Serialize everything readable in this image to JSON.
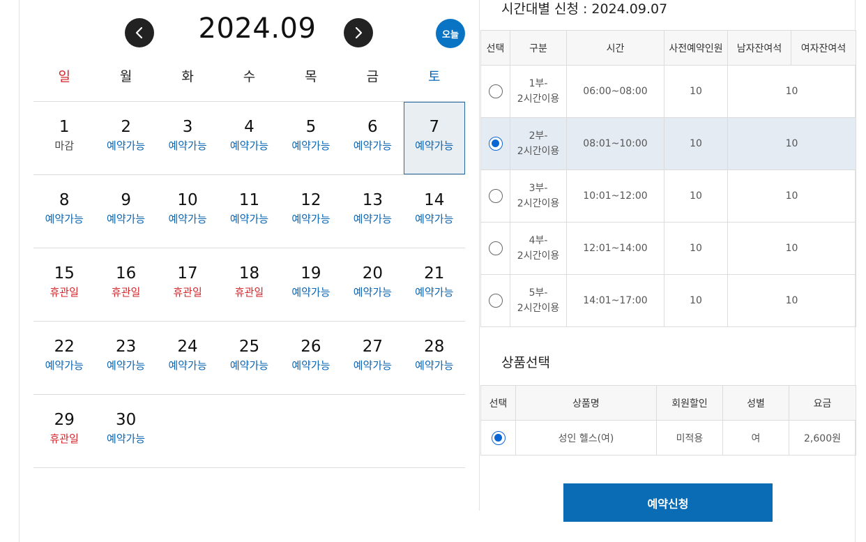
{
  "calendar": {
    "title": "2024.09",
    "prev_icon": "chevron-left-icon",
    "next_icon": "chevron-right-icon",
    "today_label": "오늘",
    "weekdays": [
      "일",
      "월",
      "화",
      "수",
      "목",
      "금",
      "토"
    ],
    "weeks": [
      [
        {
          "day": "1",
          "status": "마감",
          "type": "end"
        },
        {
          "day": "2",
          "status": "예약가능",
          "type": "avail"
        },
        {
          "day": "3",
          "status": "예약가능",
          "type": "avail"
        },
        {
          "day": "4",
          "status": "예약가능",
          "type": "avail"
        },
        {
          "day": "5",
          "status": "예약가능",
          "type": "avail"
        },
        {
          "day": "6",
          "status": "예약가능",
          "type": "avail"
        },
        {
          "day": "7",
          "status": "예약가능",
          "type": "avail",
          "selected": true
        }
      ],
      [
        {
          "day": "8",
          "status": "예약가능",
          "type": "avail"
        },
        {
          "day": "9",
          "status": "예약가능",
          "type": "avail"
        },
        {
          "day": "10",
          "status": "예약가능",
          "type": "avail"
        },
        {
          "day": "11",
          "status": "예약가능",
          "type": "avail"
        },
        {
          "day": "12",
          "status": "예약가능",
          "type": "avail"
        },
        {
          "day": "13",
          "status": "예약가능",
          "type": "avail"
        },
        {
          "day": "14",
          "status": "예약가능",
          "type": "avail"
        }
      ],
      [
        {
          "day": "15",
          "status": "휴관일",
          "type": "closed"
        },
        {
          "day": "16",
          "status": "휴관일",
          "type": "closed"
        },
        {
          "day": "17",
          "status": "휴관일",
          "type": "closed"
        },
        {
          "day": "18",
          "status": "휴관일",
          "type": "closed"
        },
        {
          "day": "19",
          "status": "예약가능",
          "type": "avail"
        },
        {
          "day": "20",
          "status": "예약가능",
          "type": "avail"
        },
        {
          "day": "21",
          "status": "예약가능",
          "type": "avail"
        }
      ],
      [
        {
          "day": "22",
          "status": "예약가능",
          "type": "avail"
        },
        {
          "day": "23",
          "status": "예약가능",
          "type": "avail"
        },
        {
          "day": "24",
          "status": "예약가능",
          "type": "avail"
        },
        {
          "day": "25",
          "status": "예약가능",
          "type": "avail"
        },
        {
          "day": "26",
          "status": "예약가능",
          "type": "avail"
        },
        {
          "day": "27",
          "status": "예약가능",
          "type": "avail"
        },
        {
          "day": "28",
          "status": "예약가능",
          "type": "avail"
        }
      ],
      [
        {
          "day": "29",
          "status": "휴관일",
          "type": "closed"
        },
        {
          "day": "30",
          "status": "예약가능",
          "type": "avail"
        },
        null,
        null,
        null,
        null,
        null
      ]
    ]
  },
  "time_section": {
    "title": "시간대별 신청 : 2024.09.07",
    "headers": [
      "선택",
      "구분",
      "시간",
      "사전예약인원",
      "남자잔여석",
      "여자잔여석"
    ],
    "rows": [
      {
        "part": "1부-",
        "usage": "2시간이용",
        "time": "06:00~08:00",
        "reserved": "10",
        "remaining": "10",
        "selected": false
      },
      {
        "part": "2부-",
        "usage": "2시간이용",
        "time": "08:01~10:00",
        "reserved": "10",
        "remaining": "10",
        "selected": true
      },
      {
        "part": "3부-",
        "usage": "2시간이용",
        "time": "10:01~12:00",
        "reserved": "10",
        "remaining": "10",
        "selected": false
      },
      {
        "part": "4부-",
        "usage": "2시간이용",
        "time": "12:01~14:00",
        "reserved": "10",
        "remaining": "10",
        "selected": false
      },
      {
        "part": "5부-",
        "usage": "2시간이용",
        "time": "14:01~17:00",
        "reserved": "10",
        "remaining": "10",
        "selected": false
      }
    ]
  },
  "product_section": {
    "title": "상품선택",
    "headers": [
      "선택",
      "상품명",
      "회원할인",
      "성별",
      "요금"
    ],
    "rows": [
      {
        "name": "성인 헬스(여)",
        "discount": "미적용",
        "gender": "여",
        "price": "2,600원",
        "selected": true
      }
    ]
  },
  "submit_label": "예약신청",
  "colors": {
    "accent": "#0a6cb5",
    "sunday": "#d3262b",
    "saturday": "#0a64b2",
    "selected_row": "#e4ebf2"
  }
}
